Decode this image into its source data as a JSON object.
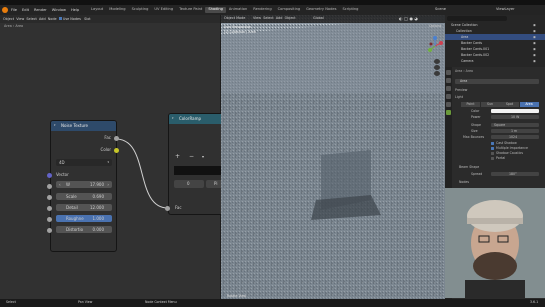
{
  "menubar": {
    "items": [
      "File",
      "Edit",
      "Render",
      "Window",
      "Help"
    ],
    "workspaces": [
      "Layout",
      "Modeling",
      "Sculpting",
      "UV Editing",
      "Texture Paint",
      "Shading",
      "Animation",
      "Rendering",
      "Compositing",
      "Geometry Nodes",
      "Scripting"
    ],
    "active_workspace": "Shading",
    "scene_label": "Scene",
    "view_layer_label": "ViewLayer"
  },
  "node_editor": {
    "header_items": [
      "Object",
      "View",
      "Select",
      "Add",
      "Node"
    ],
    "use_nodes_label": "Use Nodes",
    "slot_label": "Slot",
    "breadcrumb": [
      "Area",
      "Area"
    ],
    "noise_node": {
      "title": "Noise Texture",
      "out_fac": "Fac",
      "out_color": "Color",
      "dimension": "4D",
      "vector_label": "Vector",
      "w_label": "W",
      "w_value": "17.900",
      "rows": [
        {
          "label": "Scale",
          "value": "0.690"
        },
        {
          "label": "Detail",
          "value": "12.000"
        },
        {
          "label": "Roughne",
          "value": "1.000"
        },
        {
          "label": "Distortio",
          "value": "0.000"
        }
      ]
    },
    "ramp_node": {
      "title": "ColorRamp",
      "plus": "+",
      "minus": "−",
      "index": "0",
      "pos_label": "Pi",
      "in_fac": "Fac"
    }
  },
  "viewport": {
    "mode": "Object Mode",
    "header_items": [
      "View",
      "Select",
      "Add",
      "Object"
    ],
    "transform": "Global",
    "overlay_text": "User Perspective",
    "overlay_sub": "(1) Collection | Area",
    "options_label": "Options",
    "footer": "Rotate View"
  },
  "outliner": {
    "search_placeholder": "",
    "items": [
      {
        "name": "Scene Collection",
        "depth": 0
      },
      {
        "name": "Collection",
        "depth": 1
      },
      {
        "name": "Area",
        "depth": 2
      },
      {
        "name": "Backer Cards",
        "depth": 2
      },
      {
        "name": "Backer Cards.001",
        "depth": 2
      },
      {
        "name": "Backer Cards.002",
        "depth": 2
      },
      {
        "name": "Camera",
        "depth": 2
      }
    ]
  },
  "properties": {
    "breadcrumb": [
      "Area",
      "Area"
    ],
    "object_name": "Area",
    "preview_label": "Preview",
    "light_label": "Light",
    "light_types": [
      "Point",
      "Sun",
      "Spot",
      "Area"
    ],
    "active_light_type": "Area",
    "color_label": "Color",
    "power_label": "Power",
    "power_value": "10 W",
    "shape_label": "Shape",
    "shape_value": "Square",
    "size_label": "Size",
    "size_value": "1 m",
    "max_bounces_label": "Max Bounces",
    "max_bounces_value": "1024",
    "cast_shadow": "Cast Shadow",
    "multiple_importance": "Multiple Importance",
    "shadow_caustics": "Shadow Caustics",
    "portal": "Portal",
    "beam_shape_label": "Beam Shape",
    "spread_label": "Spread",
    "spread_value": "180°",
    "nodes_label": "Nodes",
    "custom_props_label": "Custom Properties"
  },
  "statusbar": {
    "left": "Select",
    "mid1": "Pan View",
    "mid2": "Node Context Menu",
    "version": "3.6.1"
  }
}
